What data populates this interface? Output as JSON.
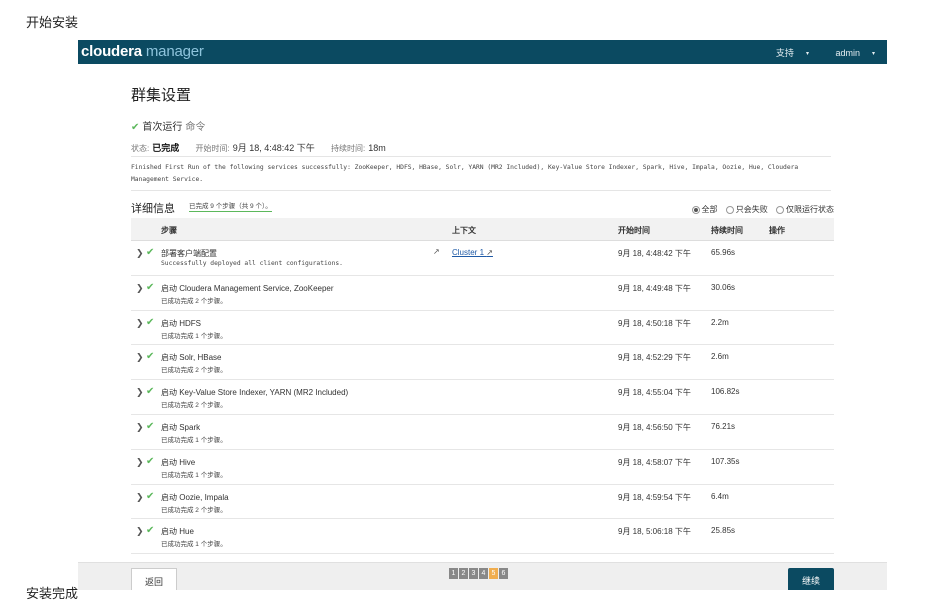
{
  "page": {
    "heading": "开始安装",
    "footer_text": "安装完成"
  },
  "topbar": {
    "logo_bold": "cloudera",
    "logo_light": "manager",
    "support": "支持",
    "user": "admin",
    "caret": "▾"
  },
  "main": {
    "title": "群集设置",
    "first_run": "首次运行",
    "first_run_cmd": "命令",
    "status_label": "状态:",
    "status_value": "已完成",
    "start_label": "开始时间:",
    "start_value": "9月 18, 4:48:42 下午",
    "duration_label": "持续时间:",
    "duration_value": "18m",
    "message": "Finished First Run of the following services successfully: ZooKeeper, HDFS, HBase, Solr, YARN (MR2 Included), Key-Value Store Indexer, Spark, Hive, Impala, Oozie, Hue, Cloudera Management Service."
  },
  "details": {
    "title": "详细信息",
    "steps_done": "已完成 9 个步骤（共 9 个）。",
    "filters": [
      "全部",
      "只会失败",
      "仅限运行状态"
    ],
    "selected_filter": "全部",
    "columns": [
      "步骤",
      "上下文",
      "开始时间",
      "持续时间",
      "操作"
    ]
  },
  "steps": [
    {
      "name": "部署客户端配置",
      "sub": "Successfully deployed all client configurations.",
      "context": "Cluster 1",
      "start": "9月 18, 4:48:42 下午",
      "duration": "65.96s"
    },
    {
      "name": "启动 Cloudera Management Service, ZooKeeper",
      "sub": "已成功完成 2 个步骤。",
      "context": "",
      "start": "9月 18, 4:49:48 下午",
      "duration": "30.06s"
    },
    {
      "name": "启动 HDFS",
      "sub": "已成功完成 1 个步骤。",
      "context": "",
      "start": "9月 18, 4:50:18 下午",
      "duration": "2.2m"
    },
    {
      "name": "启动 Solr, HBase",
      "sub": "已成功完成 2 个步骤。",
      "context": "",
      "start": "9月 18, 4:52:29 下午",
      "duration": "2.6m"
    },
    {
      "name": "启动 Key-Value Store Indexer, YARN (MR2 Included)",
      "sub": "已成功完成 2 个步骤。",
      "context": "",
      "start": "9月 18, 4:55:04 下午",
      "duration": "106.82s"
    },
    {
      "name": "启动 Spark",
      "sub": "已成功完成 1 个步骤。",
      "context": "",
      "start": "9月 18, 4:56:50 下午",
      "duration": "76.21s"
    },
    {
      "name": "启动 Hive",
      "sub": "已成功完成 1 个步骤。",
      "context": "",
      "start": "9月 18, 4:58:07 下午",
      "duration": "107.35s"
    },
    {
      "name": "启动 Oozie, Impala",
      "sub": "已成功完成 2 个步骤。",
      "context": "",
      "start": "9月 18, 4:59:54 下午",
      "duration": "6.4m"
    },
    {
      "name": "启动 Hue",
      "sub": "已成功完成 1 个步骤。",
      "context": "",
      "start": "9月 18, 5:06:18 下午",
      "duration": "25.85s"
    }
  ],
  "footer": {
    "back": "返回",
    "continue": "继续",
    "pages": [
      "1",
      "2",
      "3",
      "4",
      "5",
      "6"
    ],
    "active_page": "5"
  },
  "icons": {
    "check": "✔",
    "expand": "❯",
    "external": "↗"
  },
  "colors": {
    "topbar": "#0b4a61",
    "success": "#5cb85c",
    "link": "#1f5aa6",
    "active_page": "#f0ad4e"
  }
}
